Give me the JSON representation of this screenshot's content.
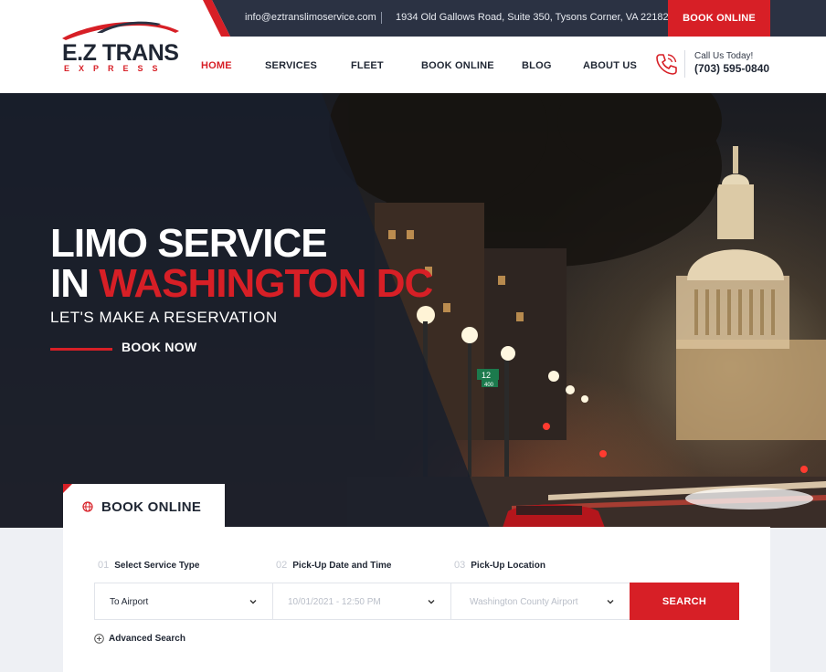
{
  "topbar": {
    "email": "info@eztranslimoservice.com",
    "address": "1934 Old Gallows Road, Suite 350, Tysons Corner, VA 22182",
    "book_label": "BOOK ONLINE"
  },
  "brand": {
    "name": "E.Z TRANS",
    "sub": "EXPRESS"
  },
  "nav": [
    "HOME",
    "SERVICES",
    "FLEET",
    "BOOK ONLINE",
    "BLOG",
    "ABOUT US"
  ],
  "nav_active": "HOME",
  "contact": {
    "label": "Call Us Today!",
    "phone": "(703) 595-0840"
  },
  "hero": {
    "title_line1": "LIMO SERVICE",
    "title_line2_prefix": "IN ",
    "title_line2_highlight": "WASHINGTON DC",
    "tagline": "LET'S MAKE A RESERVATION",
    "cta": "BOOK NOW",
    "street_sign_top": "12",
    "street_sign_bottom": "400"
  },
  "booking": {
    "tab_label": "BOOK ONLINE",
    "steps": [
      {
        "num": "01",
        "label": "Select Service Type"
      },
      {
        "num": "02",
        "label": "Pick-Up Date and Time"
      },
      {
        "num": "03",
        "label": "Pick-Up Location"
      }
    ],
    "service_type": "To Airport",
    "datetime_placeholder": "10/01/2021 - 12:50 PM",
    "location_placeholder": "Washington County Airport",
    "search_label": "SEARCH",
    "advanced_label": "Advanced Search"
  },
  "colors": {
    "accent": "#d71f26",
    "dark": "#2b3243",
    "text": "#1f2633"
  }
}
